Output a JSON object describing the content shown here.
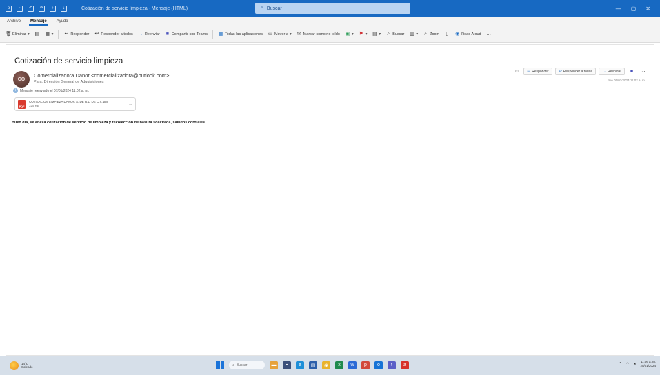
{
  "titlebar": {
    "title": "Cotización de servicio limpieza - Mensaje (HTML)",
    "search_placeholder": "Buscar",
    "quick_icons": [
      "outlook-icon",
      "save-icon",
      "undo-icon",
      "redo-icon",
      "up-icon",
      "down-icon"
    ]
  },
  "tabs": [
    {
      "label": "Archivo"
    },
    {
      "label": "Mensaje"
    },
    {
      "label": "Ayuda"
    }
  ],
  "ribbon": {
    "delete_label": "Eliminar",
    "reply_label": "Responder",
    "reply_all_label": "Responder a todos",
    "forward_label": "Reenviar",
    "teams_label": "Compartir con Teams",
    "apps_label": "Todas las aplicaciones",
    "move_label": "Mover a",
    "mark_unread_label": "Marcar como no leído",
    "find_label": "Buscar",
    "zoom_label": "Zoom",
    "reader_label": "Read Aloud"
  },
  "message": {
    "subject": "Cotización de servicio limpieza",
    "avatar_initials": "CO",
    "from": "Comercializadora Danor <comercializadora@outlook.com>",
    "to": "Para: Dirección General de Adquisiciones",
    "forwarded": "Mensaje reenviado el 07/01/2024 11:02 a. m.",
    "attachment": {
      "name": "COTIZACION LIMPIEZA DANOR S. DE R.L. DE C.V..pdf",
      "size": "325 KB"
    },
    "body": "Buen día, se anexa cotización de servicio de limpieza y recolección de basura solicitada, saludos cordiales"
  },
  "actions": {
    "reply_label": "Responder",
    "reply_all_label": "Responder a todos",
    "forward_label": "Reenviar",
    "date": "mié 05/01/2024 11:02 a. m."
  },
  "taskbar": {
    "weather_temp": "14°C",
    "weather_desc": "Soleado",
    "search_placeholder": "Buscar",
    "time": "11:06 a. m.",
    "date": "25/01/2024"
  }
}
